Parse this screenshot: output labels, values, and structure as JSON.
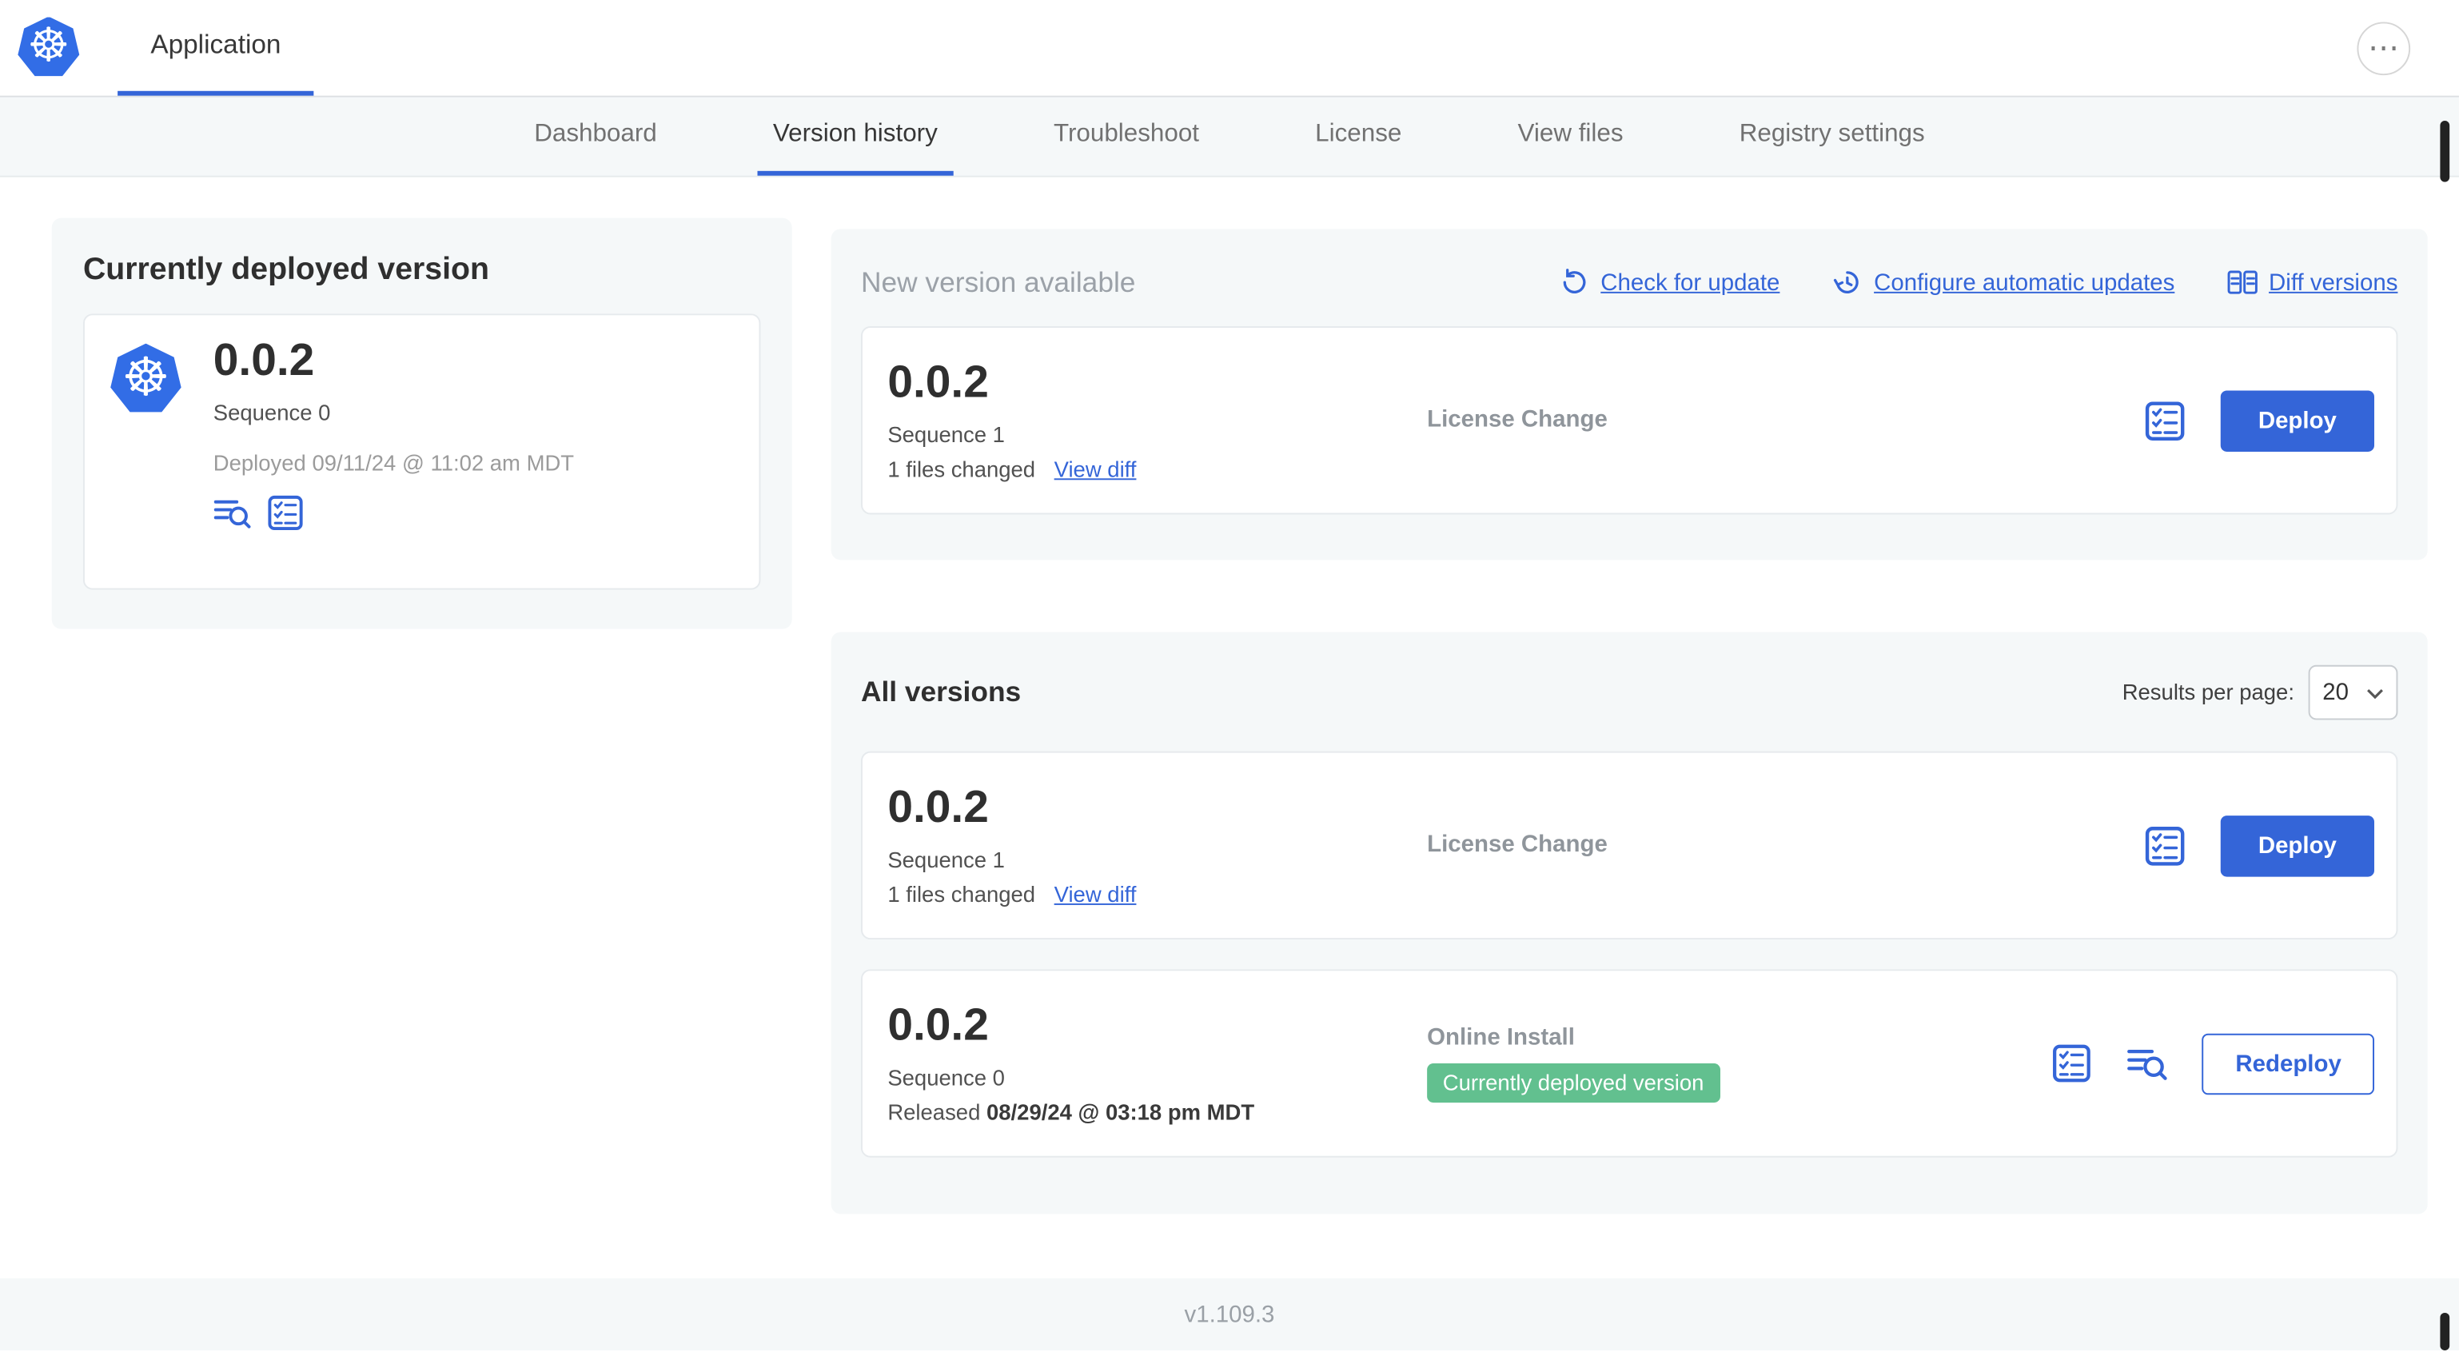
{
  "header": {
    "app_name": "Application",
    "logo_glyph": "☸",
    "more_glyph": "⋯"
  },
  "nav": {
    "active_tab": "Version history",
    "tabs": [
      {
        "label": "Dashboard"
      },
      {
        "label": "Version history"
      },
      {
        "label": "Troubleshoot"
      },
      {
        "label": "License"
      },
      {
        "label": "View files"
      },
      {
        "label": "Registry settings"
      }
    ]
  },
  "currently_deployed": {
    "title": "Currently deployed version",
    "version": "0.0.2",
    "sequence": "Sequence 0",
    "deployed_at": "Deployed 09/11/24 @ 11:02 am MDT"
  },
  "new_version": {
    "heading": "New version available",
    "check_for_update": "Check for update",
    "configure_automatic_updates": "Configure automatic updates",
    "diff_versions": "Diff versions",
    "version": "0.0.2",
    "sequence": "Sequence 1",
    "files_changed": "1 files changed",
    "view_diff": "View diff",
    "source": "License Change",
    "deploy": "Deploy"
  },
  "all_versions": {
    "heading": "All versions",
    "results_per_page_label": "Results per page:",
    "results_per_page": "20",
    "rows": [
      {
        "version": "0.0.2",
        "sequence": "Sequence 1",
        "files_changed": "1 files changed",
        "view_diff": "View diff",
        "source": "License Change",
        "action": "Deploy"
      },
      {
        "version": "0.0.2",
        "sequence": "Sequence 0",
        "released_prefix": "Released",
        "released_date": "08/29/24 @ 03:18 pm MDT",
        "source": "Online Install",
        "badge": "Currently deployed version",
        "action": "Redeploy"
      }
    ]
  },
  "footer": {
    "version": "v1.109.3"
  },
  "colors": {
    "primary_blue": "#3465d8",
    "logo_blue": "#326de6",
    "badge_green": "#62c08f",
    "panel_bg": "#f5f8f9",
    "gray_text": "#9b9b9b"
  }
}
